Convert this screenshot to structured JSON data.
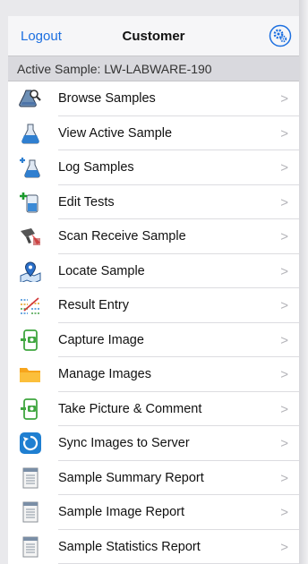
{
  "header": {
    "logout_label": "Logout",
    "title": "Customer",
    "settings_icon": "settings-gear-icon"
  },
  "banner": {
    "text": "Active Sample: LW-LABWARE-190"
  },
  "menu": {
    "items": [
      {
        "label": "Browse Samples",
        "icon": "flask-search-icon"
      },
      {
        "label": "View Active Sample",
        "icon": "flask-icon"
      },
      {
        "label": "Log Samples",
        "icon": "flask-add-icon"
      },
      {
        "label": "Edit Tests",
        "icon": "beaker-add-icon"
      },
      {
        "label": "Scan Receive Sample",
        "icon": "barcode-scanner-icon"
      },
      {
        "label": "Locate Sample",
        "icon": "map-pin-icon"
      },
      {
        "label": "Result Entry",
        "icon": "chart-entry-icon"
      },
      {
        "label": "Capture Image",
        "icon": "phone-camera-icon"
      },
      {
        "label": "Manage Images",
        "icon": "folder-icon"
      },
      {
        "label": "Take Picture & Comment",
        "icon": "phone-camera-icon"
      },
      {
        "label": "Sync Images to Server",
        "icon": "sync-icon"
      },
      {
        "label": "Sample Summary Report",
        "icon": "report-icon"
      },
      {
        "label": "Sample Image Report",
        "icon": "report-icon"
      },
      {
        "label": "Sample Statistics Report",
        "icon": "report-icon"
      }
    ],
    "chevron": ">"
  },
  "colors": {
    "accent": "#1c6fe0",
    "banner_bg": "#d9d9de"
  }
}
